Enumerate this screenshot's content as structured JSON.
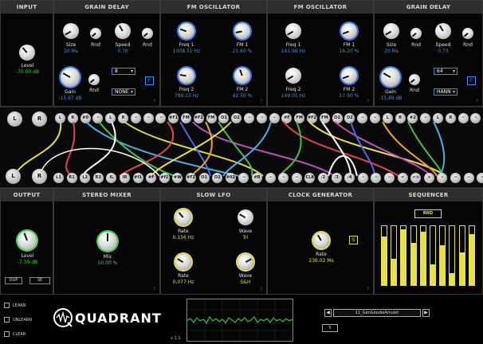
{
  "modules": {
    "input": {
      "title": "INPUT",
      "level_label": "Level",
      "level_value": "-70.00 dB"
    },
    "grain1": {
      "title": "GRAIN DELAY",
      "size_label": "Size",
      "size_value": "20 Ms",
      "rnd_label": "Rnd",
      "speed_label": "Speed",
      "speed_value": "0.76",
      "gain_label": "Gain",
      "gain_value": "-15.67 dB",
      "dd1": "8",
      "dd2": "NONE",
      "f": "F"
    },
    "fm1": {
      "title": "FM OSCILLATOR",
      "freq1_label": "Freq 1",
      "freq1_value": "1008.51 Hz",
      "fm1_label": "FM 1",
      "fm1_value": "21.60 %",
      "freq2_label": "Freq 2",
      "freq2_value": "789.13 Hz",
      "fm2_label": "FM 2",
      "fm2_value": "42.50 %"
    },
    "fm2": {
      "title": "FM OSCILLATOR",
      "freq1_label": "Freq 1",
      "freq1_value": "141.99 Hz",
      "fm1_label": "FM 1",
      "fm1_value": "16.20 %",
      "freq2_label": "Freq 2",
      "freq2_value": "149.01 Hz",
      "fm2_label": "FM 2",
      "fm2_value": "17.90 %"
    },
    "grain2": {
      "title": "GRAIN DELAY",
      "size_label": "Size",
      "size_value": "20 Ms",
      "rnd_label": "Rnd",
      "speed_label": "Speed",
      "speed_value": "0.73",
      "gain_label": "Gain",
      "gain_value": "-15.89 dB",
      "dd1": "64",
      "dd2": "HANN",
      "f": "F"
    },
    "output": {
      "title": "OUTPUT",
      "level_label": "Level",
      "level_value": "-7.39 dB",
      "btn1": "DUP",
      "btn2": "SE"
    },
    "mixer": {
      "title": "STEREO MIXER",
      "mix_label": "Mix",
      "mix_value": "50.00 %"
    },
    "lfo": {
      "title": "SLOW LFO",
      "rate1_label": "Rate",
      "rate1_value": "0.156 Hz",
      "wave1_label": "Wave",
      "wave1_value": "Tri",
      "rate2_label": "Rate",
      "rate2_value": "0.077 Hz",
      "wave2_label": "Wave",
      "wave2_value": "S&H"
    },
    "clock": {
      "title": "CLOCK GENERATOR",
      "rate_label": "Rate",
      "rate_value": "236.02 Ms",
      "s_btn": "S"
    },
    "seq": {
      "title": "SEQUENCER",
      "rnd_btn": "RND",
      "bars": [
        0.82,
        0.45,
        0.95,
        0.72,
        0.9,
        0.35,
        0.68,
        0.2,
        0.55,
        0.86
      ]
    }
  },
  "question_mark": "?",
  "patch": {
    "top_big": [
      "L",
      "R"
    ],
    "top_jacks": [
      "L",
      "R",
      "#0",
      "~",
      "L",
      "R",
      "~",
      "~",
      "~",
      "#F1",
      "FM",
      "#F2",
      "FM",
      "O1",
      "O2",
      "~",
      "~",
      "~",
      "#F",
      "FM",
      "#F2",
      "FM",
      "O1",
      "O2",
      "~",
      "~",
      "L",
      "R",
      "#2",
      "~",
      "L",
      "R",
      "~",
      "~",
      "~"
    ],
    "bottom_big": [
      "L",
      "R"
    ],
    "bottom_jacks": [
      "L1",
      "R1",
      "L2",
      "R2",
      "IL",
      "IR",
      "#f1",
      "#F",
      "#f2",
      "#W",
      "#F2",
      "O1",
      "O2",
      "#02",
      "~",
      "#R",
      "~",
      "~",
      "~",
      "CLK",
      "/2",
      "/3",
      "/4",
      "~",
      "~",
      "~",
      "<",
      "<>",
      ">",
      "~",
      "~",
      "~",
      "~"
    ]
  },
  "bottom_bar": {
    "learn": "LEARN",
    "unlearn": "UNLEARN",
    "clear": "CLEAR",
    "logo": "QUADRANT",
    "version": "v 1.1",
    "preset_name": "11_GenGoodieAmulet",
    "preset_num": "5"
  },
  "colors": {
    "accent_blue": "#4a8ff0",
    "green": "#41d64b",
    "yellow": "#e8e04a"
  }
}
